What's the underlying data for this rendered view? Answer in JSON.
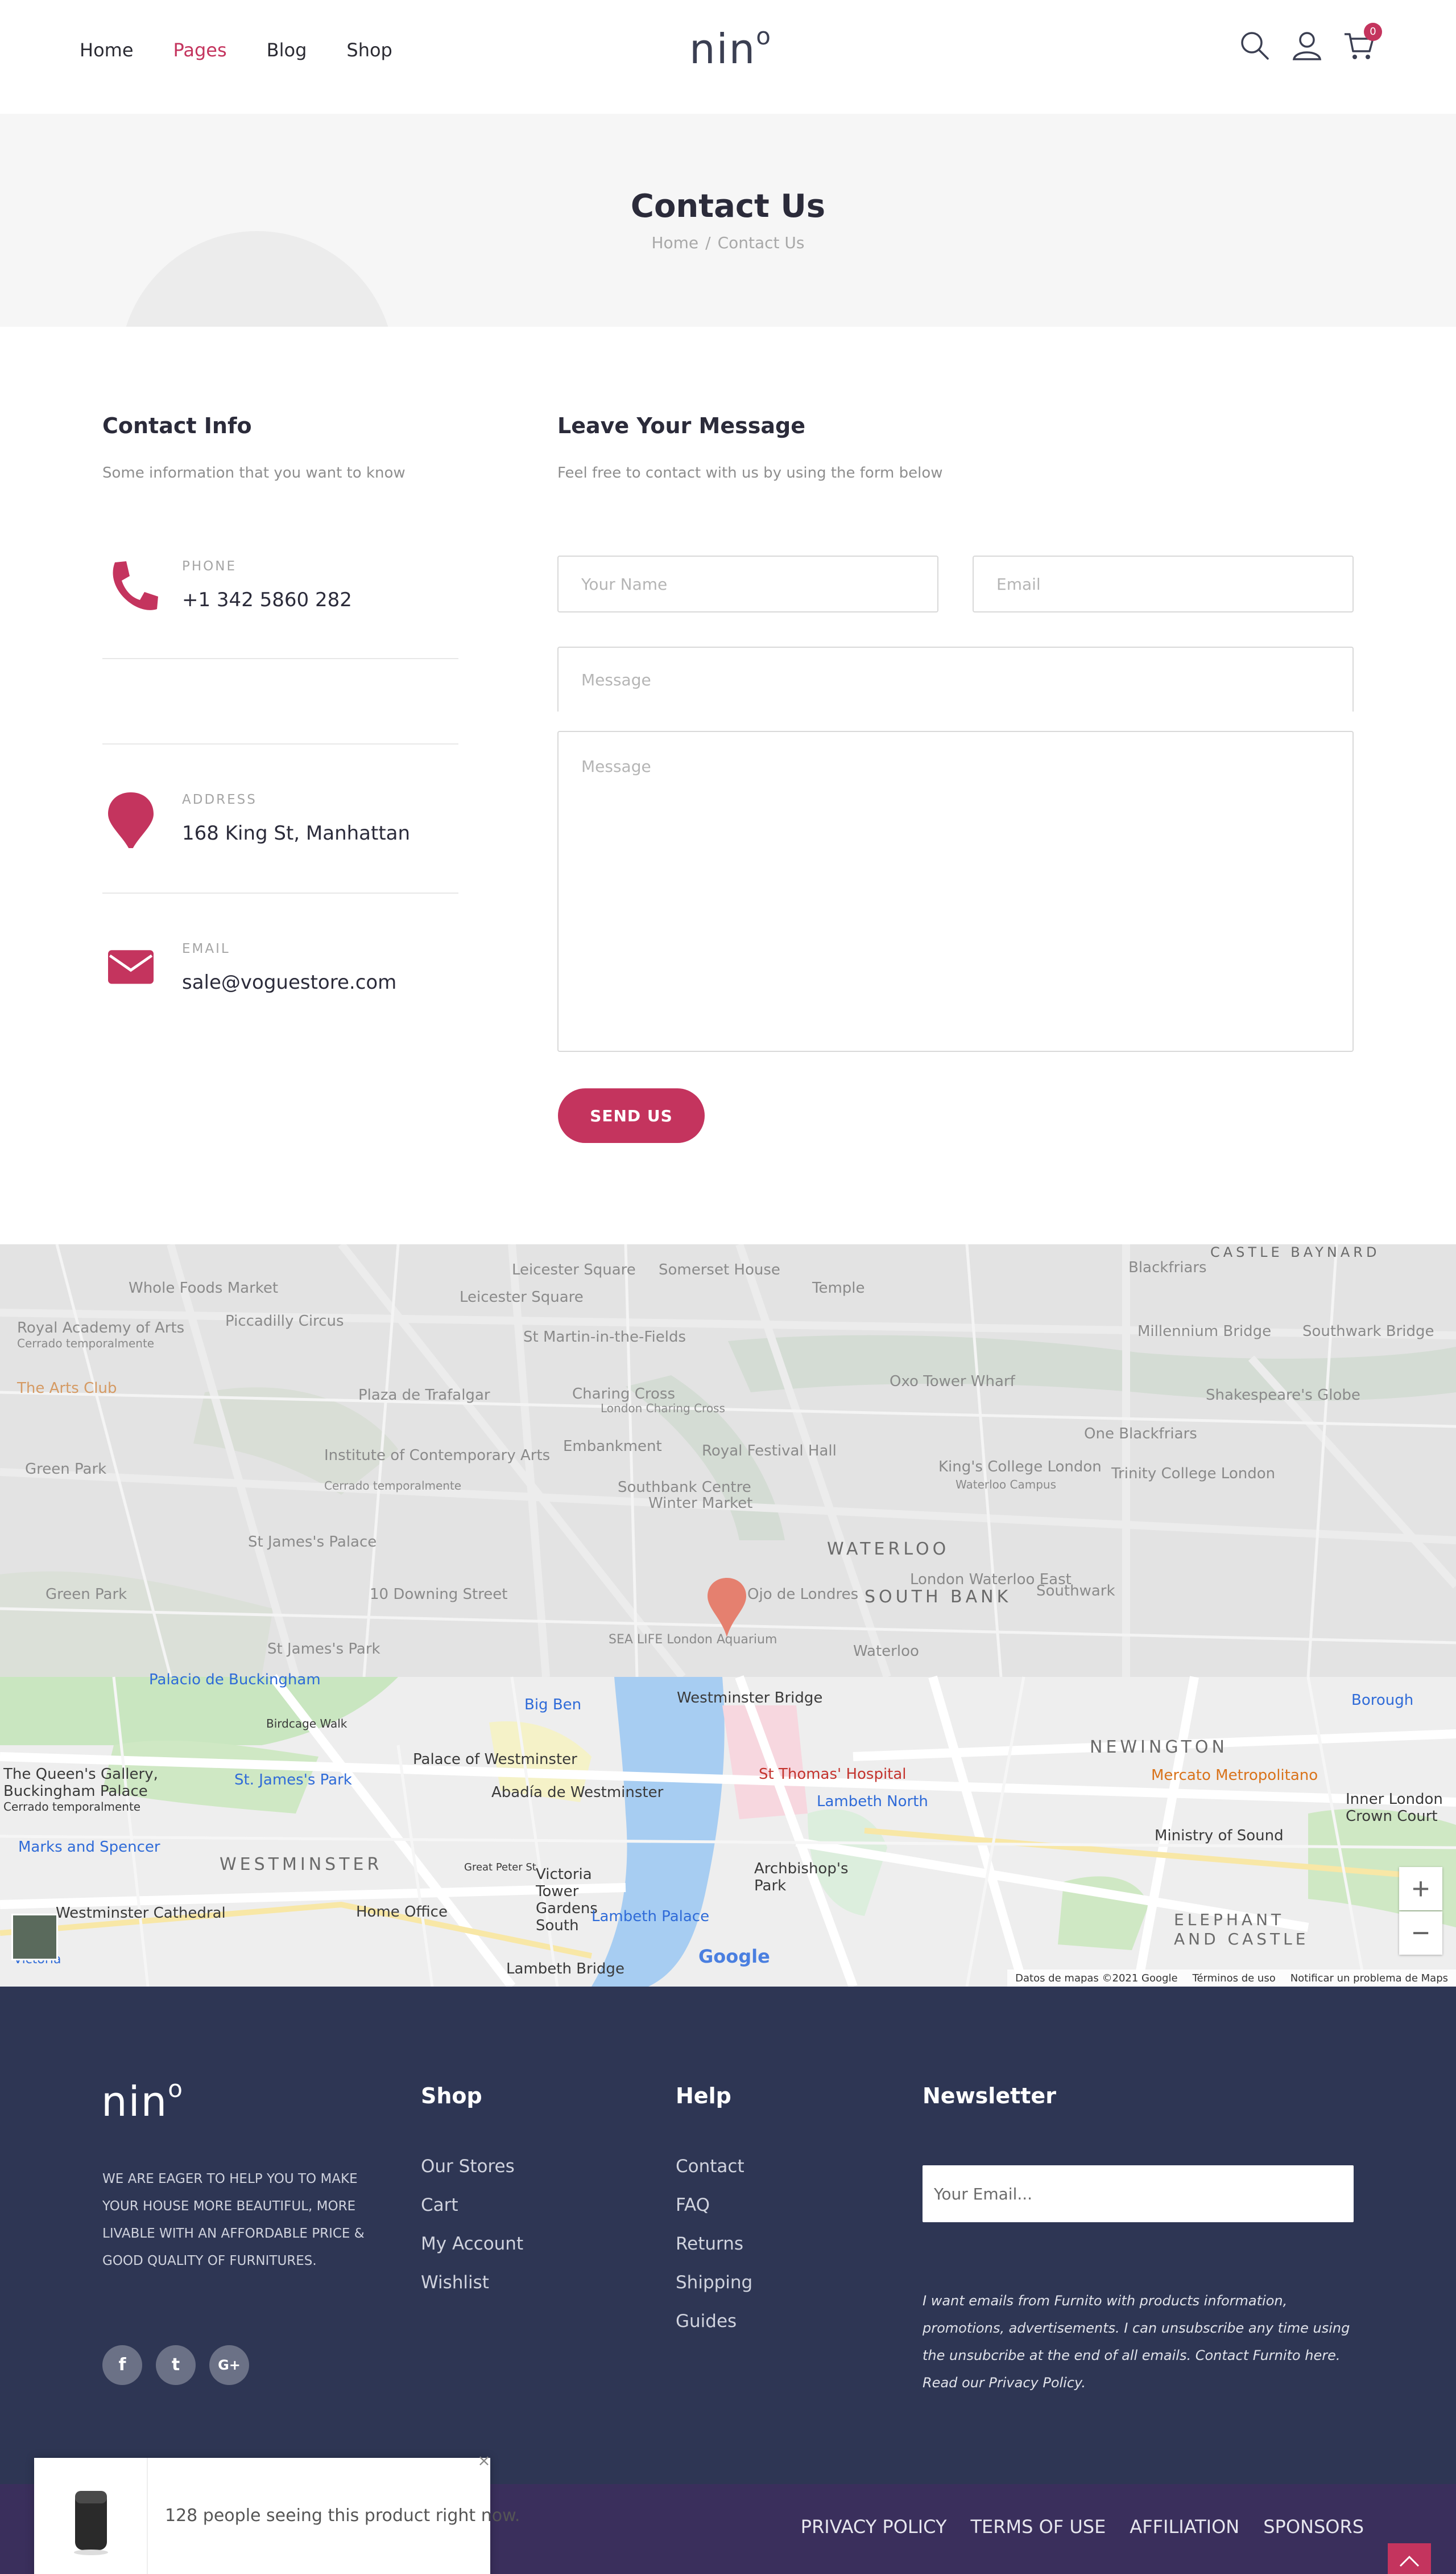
{
  "header": {
    "nav": [
      "Home",
      "Pages",
      "Blog",
      "Shop"
    ],
    "logo": "nin",
    "logo_mark": "o",
    "cart_count": "0",
    "icons": [
      "search-icon",
      "user-icon",
      "cart-icon"
    ]
  },
  "page_title": {
    "title": "Contact Us",
    "breadcrumb": [
      "Home",
      "/",
      "Contact Us"
    ]
  },
  "contact_info": {
    "heading": "Contact Info",
    "subtitle": "Some information that you want to know",
    "items": [
      {
        "label": "PHONE",
        "value": "+1 342 5860 282",
        "icon": "phone-icon"
      },
      {
        "label": "ADDRESS",
        "value": "168 King St, Manhattan",
        "icon": "location-pin-icon"
      },
      {
        "label": "EMAIL",
        "value": "sale@voguestore.com",
        "icon": "envelope-icon"
      }
    ]
  },
  "form": {
    "heading": "Leave Your Message",
    "subtitle": "Feel free to contact with us by using the form below",
    "name_placeholder": "Your Name",
    "email_placeholder": "Email",
    "subject_placeholder": "Message",
    "message_placeholder": "Message",
    "submit_label": "SEND US"
  },
  "map": {
    "labels": {
      "whole_foods": "Whole Foods Market",
      "leicester_sq_stn": "Leicester Square",
      "leicester_sq": "Leicester Square",
      "somerset": "Somerset House",
      "temple": "Temple",
      "blackfriars": "Blackfriars",
      "castle_baynard": "CASTLE BAYNARD",
      "royal_academy": "Royal Academy of Arts",
      "royal_academy_sub": "Cerrado temporalmente",
      "piccadilly": "Piccadilly Circus",
      "st_martin": "St Martin-in-the-Fields",
      "millennium": "Millennium Bridge",
      "southwark_br": "Southwark Bridge",
      "arts_club": "The Arts Club",
      "plaza": "Plaza de Trafalgar",
      "charing": "Charing Cross",
      "charing_sub": "London Charing Cross",
      "oxo": "Oxo Tower Wharf",
      "shakespeare": "Shakespeare's Globe",
      "one_blackfriars": "One Blackfriars",
      "ica": "Institute of Contemporary Arts",
      "ica_sub": "Cerrado temporalmente",
      "embankment": "Embankment",
      "royal_festival": "Royal Festival Hall",
      "green_park": "Green Park",
      "southbank": "Southbank Centre",
      "winter_market": "Winter Market",
      "kings_college": "King's College London",
      "kings_college_sub": "Waterloo Campus",
      "trinity": "Trinity College London",
      "st_james_palace": "St James's Palace",
      "waterloo": "WATERLOO",
      "london_waterloo": "London Waterloo East",
      "green_park_2": "Green Park",
      "downing": "10 Downing Street",
      "ojo": "Ojo de Londres",
      "south_bank": "SOUTH BANK",
      "southwark": "Southwark",
      "st_james_park": "St James's Park",
      "sealife": "SEA LIFE London Aquarium",
      "waterloo_stn": "Waterloo",
      "buckingham": "Palacio de Buckingham",
      "big_ben": "Big Ben",
      "westminster_br": "Westminster Bridge",
      "borough": "Borough",
      "newington": "NEWINGTON",
      "queens_gallery": "The Queen's Gallery, Buckingham Palace",
      "queens_sub": "Cerrado temporalmente",
      "palace_westminster": "Palace of Westminster",
      "st_thomas": "St Thomas' Hospital",
      "mercato": "Mercato Metropolitano",
      "st_james_park_stn": "St. James's Park",
      "abadia": "Abadía de Westminster",
      "lambeth_north": "Lambeth North",
      "inner_london": "Inner London Crown Court",
      "marks": "Marks and Spencer",
      "ministry": "Ministry of Sound",
      "westminster": "WESTMINSTER",
      "archbishop": "Archbishop's Park",
      "victoria_tower": "Victoria Tower Gardens South",
      "cathedral": "Westminster Cathedral",
      "home_office": "Home Office",
      "lambeth_palace": "Lambeth Palace",
      "elephant": "ELEPHANT AND CASTLE",
      "victoria": "Victoria",
      "lambeth_bridge": "Lambeth Bridge",
      "birdcage": "Birdcage Walk",
      "great_peter": "Great Peter St"
    },
    "google": "Google",
    "attribution": [
      "Datos de mapas ©2021 Google",
      "Términos de uso",
      "Notificar un problema de Maps"
    ],
    "zoom_in": "+",
    "zoom_out": "−"
  },
  "footer": {
    "logo": "nin",
    "logo_mark": "o",
    "about": "WE ARE EAGER TO HELP YOU TO MAKE YOUR HOUSE MORE BEAUTIFUL, MORE LIVABLE WITH AN AFFORDABLE PRICE & GOOD QUALITY OF FURNITURES.",
    "socials": [
      {
        "icon": "facebook-icon",
        "glyph": "f"
      },
      {
        "icon": "twitter-icon",
        "glyph": "t"
      },
      {
        "icon": "google-plus-icon",
        "glyph": "G+"
      }
    ],
    "shop": {
      "heading": "Shop",
      "links": [
        "Our Stores",
        "Cart",
        "My Account",
        "Wishlist"
      ]
    },
    "help": {
      "heading": "Help",
      "links": [
        "Contact",
        "FAQ",
        "Returns",
        "Shipping",
        "Guides"
      ]
    },
    "newsletter": {
      "heading": "Newsletter",
      "placeholder": "Your Email...",
      "note": "I want emails from Furnito with products information, promotions, advertisements. I can unsubscribe any time using the unsubcribe at the end of all emails. Contact Furnito here. Read our Privacy Policy."
    },
    "legal": [
      "PRIVACY POLICY",
      "TERMS OF USE",
      "AFFILIATION",
      "SPONSORS"
    ]
  },
  "popup": {
    "message": "128 people seeing this product right now.",
    "close": "×"
  },
  "colors": {
    "accent": "#c4345e",
    "footer_bg": "#2e3654",
    "bottom_bar": "#3a2f5c",
    "map_bg": "#e6e6e6"
  }
}
